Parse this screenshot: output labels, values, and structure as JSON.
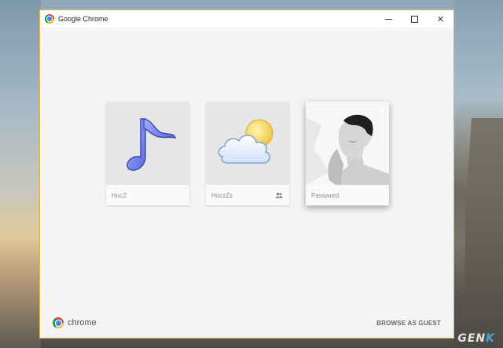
{
  "window": {
    "title": "Google Chrome",
    "controls": {
      "minimize": "minimize-icon",
      "maximize": "maximize-icon",
      "close": "✕"
    }
  },
  "profiles": [
    {
      "name": "HocZ",
      "avatar": "music-note-icon",
      "supervised": false
    },
    {
      "name": "HoczZz",
      "avatar": "cloud-sun-icon",
      "supervised": true
    },
    {
      "name": "Password",
      "avatar": "photo-avatar",
      "supervised": false,
      "active": true
    }
  ],
  "footer": {
    "logo_text": "chrome",
    "guest_label": "BROWSE AS GUEST"
  },
  "watermark": {
    "text": "GEN",
    "accent": "K"
  },
  "colors": {
    "window_border": "#e0b34a",
    "background": "#f4f4f4",
    "card_image_bg": "#e6e6e6"
  }
}
